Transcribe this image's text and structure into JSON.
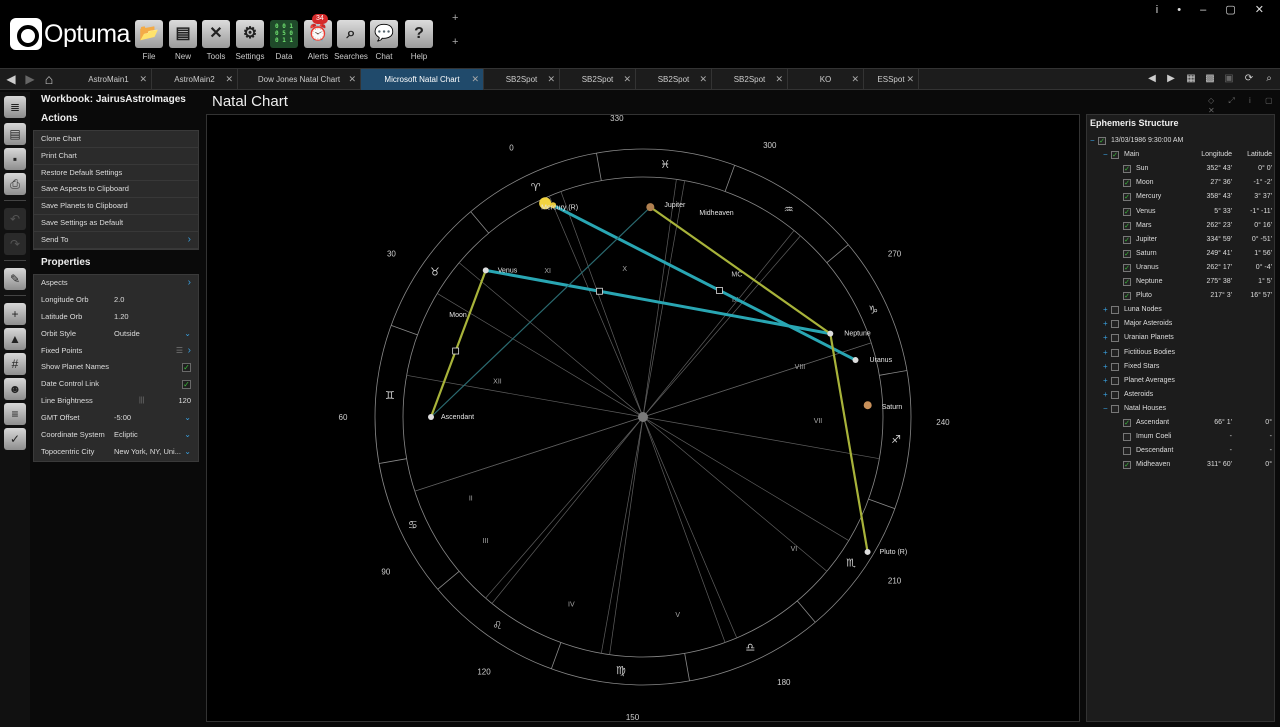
{
  "app": {
    "brand": "Optuma"
  },
  "toolbar": {
    "buttons": [
      {
        "name": "file-button",
        "icon": "folder-icon",
        "glyph": "📂",
        "label": "File"
      },
      {
        "name": "new-button",
        "icon": "new-document-icon",
        "glyph": "▤",
        "label": "New"
      },
      {
        "name": "tools-button",
        "icon": "tools-icon",
        "glyph": "✕",
        "label": "Tools"
      },
      {
        "name": "settings-button",
        "icon": "gear-icon",
        "glyph": "⚙",
        "label": "Settings"
      },
      {
        "name": "data-button",
        "icon": "data-icon",
        "glyph": "",
        "label": "Data"
      },
      {
        "name": "alerts-button",
        "icon": "alarm-clock-icon",
        "glyph": "⏰",
        "label": "Alerts"
      },
      {
        "name": "searches-button",
        "icon": "search-icon",
        "glyph": "⌕",
        "label": "Searches"
      },
      {
        "name": "chat-button",
        "icon": "chat-icon",
        "glyph": "💬",
        "label": "Chat"
      },
      {
        "name": "help-button",
        "icon": "help-icon",
        "glyph": "?",
        "label": "Help"
      }
    ],
    "alerts_badge": "34",
    "data_icon_text": "0 0 1\n0 5 0\n0 1 1",
    "window_controls": "i • – ▢ ✕"
  },
  "tabs": [
    {
      "label": "AstroMain1",
      "active": false
    },
    {
      "label": "AstroMain2",
      "active": false
    },
    {
      "label": "Dow Jones Natal Chart",
      "active": false
    },
    {
      "label": "Microsoft Natal Chart",
      "active": true
    },
    {
      "label": "SB2Spot",
      "active": false
    },
    {
      "label": "SB2Spot",
      "active": false
    },
    {
      "label": "SB2Spot",
      "active": false
    },
    {
      "label": "SB2Spot",
      "active": false
    },
    {
      "label": "KO",
      "active": false
    },
    {
      "label": "ESSpot",
      "active": false
    }
  ],
  "workbook": {
    "title": "Workbook: JairusAstroImages"
  },
  "actions": {
    "heading": "Actions",
    "items": [
      {
        "label": "Clone Chart"
      },
      {
        "label": "Print Chart"
      },
      {
        "label": "Restore Default Settings"
      },
      {
        "label": "Save Aspects to Clipboard"
      },
      {
        "label": "Save Planets to Clipboard"
      },
      {
        "label": "Save Settings as Default"
      },
      {
        "label": "Send To",
        "chevron": true
      }
    ]
  },
  "properties": {
    "heading": "Properties",
    "rows": [
      {
        "label": "Aspects",
        "kind": "chevron"
      },
      {
        "label": "Longitude Orb",
        "value": "2.0",
        "kind": "text"
      },
      {
        "label": "Latitude Orb",
        "value": "1.20",
        "kind": "text"
      },
      {
        "label": "Orbit Style",
        "value": "Outside",
        "kind": "dropdown"
      },
      {
        "label": "Fixed Points",
        "kind": "list"
      },
      {
        "label": "Show Planet Names",
        "kind": "check",
        "checked": true
      },
      {
        "label": "Date Control Link",
        "kind": "check",
        "checked": true
      },
      {
        "label": "Line Brightness",
        "value": "120",
        "kind": "slider"
      },
      {
        "label": "GMT Offset",
        "value": "-5:00",
        "kind": "dropdown"
      },
      {
        "label": "Coordinate System",
        "value": "Ecliptic",
        "kind": "dropdown"
      },
      {
        "label": "Topocentric City",
        "value": "New York, NY, Uni...",
        "kind": "dropdown"
      }
    ]
  },
  "chart": {
    "title": "Natal Chart",
    "degree_labels": [
      "0",
      "30",
      "60",
      "90",
      "120",
      "150",
      "180",
      "210",
      "240",
      "270",
      "300",
      "330"
    ],
    "houses": [
      "XII",
      "XI",
      "X",
      "IX",
      "VIII",
      "VII",
      "VI",
      "V",
      "IV",
      "III",
      "II"
    ],
    "midheaven_short": "MC",
    "points": [
      {
        "name": "Mercury (R)",
        "color": "#e8c93a"
      },
      {
        "name": "Jupiter",
        "color": "#b08050"
      },
      {
        "name": "Venus",
        "color": "#ddd"
      },
      {
        "name": "Moon",
        "color": "#ddd"
      },
      {
        "name": "Midheaven",
        "color": "#ddd"
      },
      {
        "name": "Neptune",
        "color": "#ddd"
      },
      {
        "name": "Uranus",
        "color": "#ddd"
      },
      {
        "name": "Saturn",
        "color": "#c8905a"
      },
      {
        "name": "Pluto (R)",
        "color": "#ddd"
      },
      {
        "name": "Ascendant",
        "color": "#ddd"
      }
    ],
    "aspect_colors": {
      "trine": "#29a6b3",
      "opposition": "#a8b33a",
      "square": "#2a6a70"
    }
  },
  "ephemeris": {
    "title": "Ephemeris Structure",
    "date": "13/03/1986 9:30:00 AM",
    "main": {
      "label": "Main",
      "col_long": "Longitude",
      "col_lat": "Latitude"
    },
    "planets": [
      {
        "name": "Sun",
        "lon": "352° 43'",
        "lat": "0° 0'"
      },
      {
        "name": "Moon",
        "lon": "27° 36'",
        "lat": "-1° -2'"
      },
      {
        "name": "Mercury",
        "lon": "358° 43'",
        "lat": "3° 37'"
      },
      {
        "name": "Venus",
        "lon": "5° 33'",
        "lat": "-1° -11'"
      },
      {
        "name": "Mars",
        "lon": "262° 23'",
        "lat": "0° 16'"
      },
      {
        "name": "Jupiter",
        "lon": "334° 59'",
        "lat": "0° -51'"
      },
      {
        "name": "Saturn",
        "lon": "249° 41'",
        "lat": "1° 56'"
      },
      {
        "name": "Uranus",
        "lon": "262° 17'",
        "lat": "0° -4'"
      },
      {
        "name": "Neptune",
        "lon": "275° 38'",
        "lat": "1° 5'"
      },
      {
        "name": "Pluto",
        "lon": "217° 3'",
        "lat": "16° 57'"
      }
    ],
    "groups": [
      "Luna Nodes",
      "Major Asteroids",
      "Uranian Planets",
      "Fictitious Bodies",
      "Fixed Stars",
      "Planet Averages",
      "Asteroids"
    ],
    "natal_houses": {
      "label": "Natal Houses",
      "items": [
        {
          "name": "Ascendant",
          "lon": "66° 1'",
          "lat": "0°",
          "checked": true
        },
        {
          "name": "Imum Coeli",
          "lon": "-",
          "lat": "-",
          "checked": false
        },
        {
          "name": "Descendant",
          "lon": "-",
          "lat": "-",
          "checked": false
        },
        {
          "name": "Midheaven",
          "lon": "311° 60'",
          "lat": "0°",
          "checked": true
        }
      ]
    }
  }
}
